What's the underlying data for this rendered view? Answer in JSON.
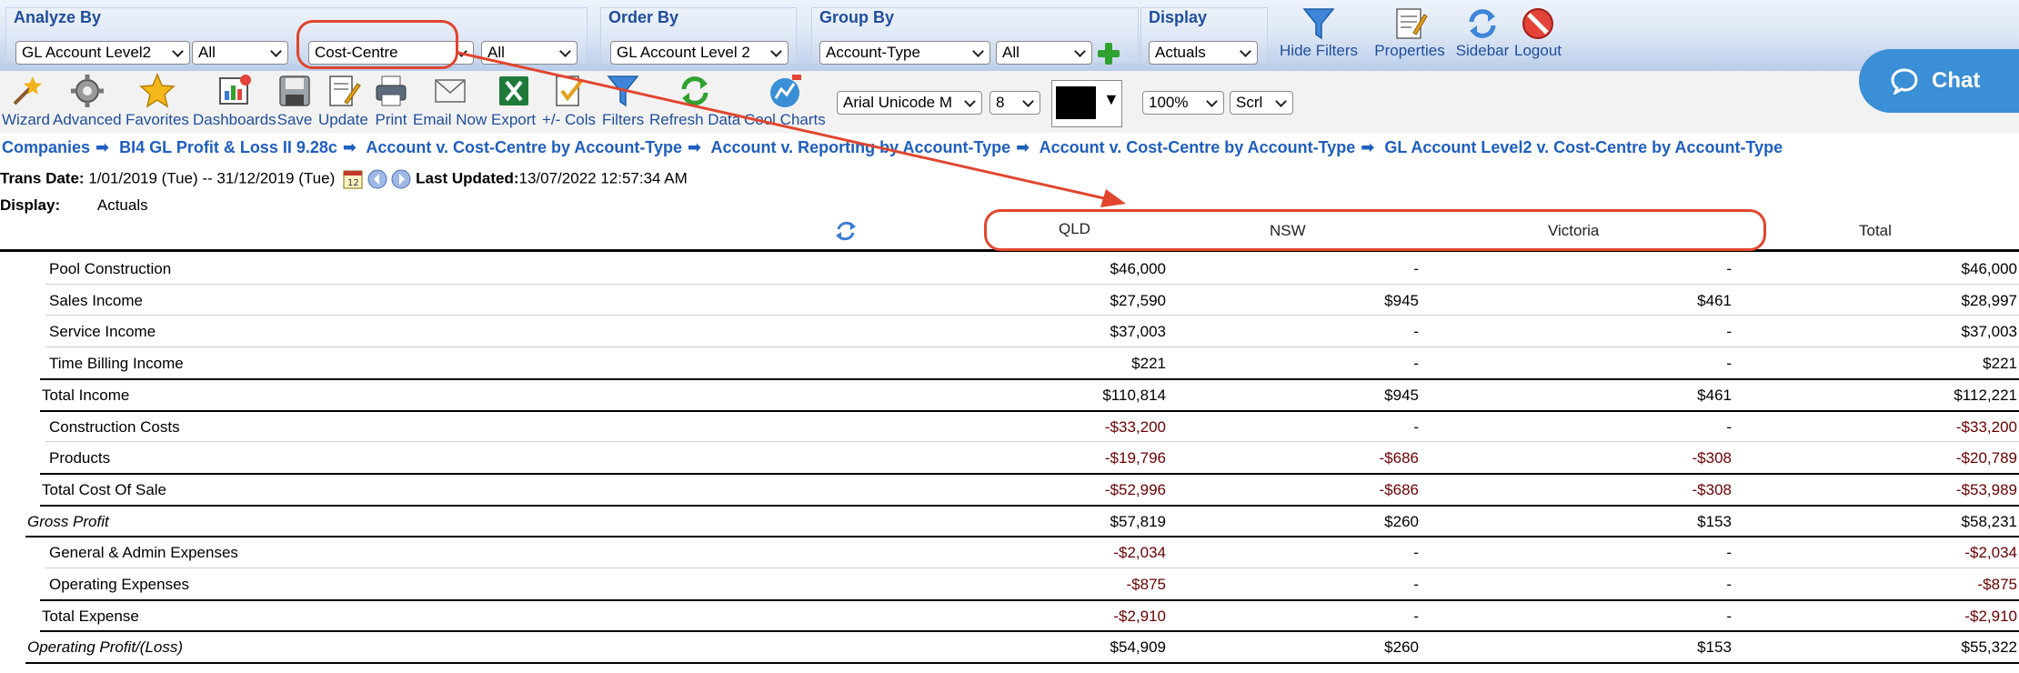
{
  "filters": {
    "analyze_by": {
      "title": "Analyze By",
      "field1": "GL Account Level2",
      "field1_value": "All",
      "field2": "Cost-Centre",
      "field2_value": "All"
    },
    "order_by": {
      "title": "Order By",
      "field": "GL Account Level 2"
    },
    "group_by": {
      "title": "Group By",
      "field": "Account-Type",
      "value": "All"
    },
    "display": {
      "title": "Display",
      "value": "Actuals"
    },
    "actions": [
      "Hide Filters",
      "Properties",
      "Sidebar",
      "Logout"
    ]
  },
  "toolbar": {
    "items": [
      "Wizard",
      "Advanced",
      "Favorites",
      "Dashboards",
      "Save",
      "Update",
      "Print",
      "Email Now",
      "Export",
      "+/- Cols",
      "Filters",
      "Refresh Data",
      "Cool Charts"
    ],
    "font": "Arial Unicode M",
    "font_size": "8",
    "zoom": "100%",
    "scroll": "Scrl"
  },
  "chat": {
    "label": "Chat"
  },
  "breadcrumb": [
    "Companies",
    "BI4 GL Profit & Loss II 9.28c",
    "Account v. Cost-Centre by Account-Type",
    "Account v. Reporting by Account-Type",
    "Account v. Cost-Centre by Account-Type",
    "GL Account Level2 v. Cost-Centre by Account-Type"
  ],
  "info": {
    "trans_date_label": "Trans Date:",
    "trans_date_value": "1/01/2019 (Tue) -- 31/12/2019 (Tue)",
    "last_updated_label": "Last Updated:",
    "last_updated_value": "13/07/2022 12:57:34 AM",
    "display_label": "Display:",
    "display_value": "Actuals"
  },
  "table": {
    "columns": [
      "QLD",
      "NSW",
      "Victoria",
      "Total"
    ],
    "rows": [
      {
        "label": "Pool Construction",
        "values": [
          "$46,000",
          "-",
          "-",
          "$46,000"
        ]
      },
      {
        "label": "Sales Income",
        "values": [
          "$27,590",
          "$945",
          "$461",
          "$28,997"
        ]
      },
      {
        "label": "Service Income",
        "values": [
          "$37,003",
          "-",
          "-",
          "$37,003"
        ]
      },
      {
        "label": "Time Billing Income",
        "values": [
          "$221",
          "-",
          "-",
          "$221"
        ]
      },
      {
        "label": "Total Income",
        "values": [
          "$110,814",
          "$945",
          "$461",
          "$112,221"
        ]
      },
      {
        "label": "Construction Costs",
        "values": [
          "-$33,200",
          "-",
          "-",
          "-$33,200"
        ]
      },
      {
        "label": "Products",
        "values": [
          "-$19,796",
          "-$686",
          "-$308",
          "-$20,789"
        ]
      },
      {
        "label": "Total Cost Of Sale",
        "values": [
          "-$52,996",
          "-$686",
          "-$308",
          "-$53,989"
        ]
      },
      {
        "label": "Gross Profit",
        "values": [
          "$57,819",
          "$260",
          "$153",
          "$58,231"
        ]
      },
      {
        "label": "General & Admin Expenses",
        "values": [
          "-$2,034",
          "-",
          "-",
          "-$2,034"
        ]
      },
      {
        "label": "Operating Expenses",
        "values": [
          "-$875",
          "-",
          "-",
          "-$875"
        ]
      },
      {
        "label": "Total Expense",
        "values": [
          "-$2,910",
          "-",
          "-",
          "-$2,910"
        ]
      },
      {
        "label": "Operating Profit/(Loss)",
        "values": [
          "$54,909",
          "$260",
          "$153",
          "$55,322"
        ]
      }
    ]
  }
}
